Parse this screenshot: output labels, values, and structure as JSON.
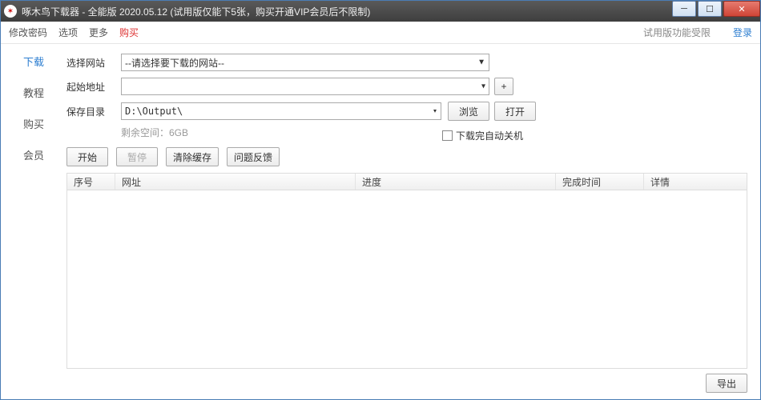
{
  "window": {
    "title": "啄木鸟下载器 - 全能版 2020.05.12 (试用版仅能下5张，购买开通VIP会员后不限制)"
  },
  "menubar": {
    "items": [
      "修改密码",
      "选项",
      "更多",
      "购买"
    ],
    "trial_notice": "试用版功能受限",
    "login": "登录"
  },
  "sidebar": {
    "tabs": [
      "下载",
      "教程",
      "购买",
      "会员"
    ],
    "active_index": 0
  },
  "form": {
    "site_label": "选择网站",
    "site_value": "--请选择要下载的网站--",
    "url_label": "起始地址",
    "url_value": "",
    "save_label": "保存目录",
    "save_value": "D:\\Output\\",
    "browse": "浏览",
    "open": "打开",
    "plus": "+",
    "free_space": "剩余空间：6GB",
    "shutdown_label": "下载完自动关机"
  },
  "actions": {
    "start": "开始",
    "pause": "暂停",
    "clear_cache": "清除缓存",
    "feedback": "问题反馈"
  },
  "table": {
    "headers": [
      "序号",
      "网址",
      "进度",
      "完成时间",
      "详情"
    ]
  },
  "footer": {
    "export": "导出"
  }
}
